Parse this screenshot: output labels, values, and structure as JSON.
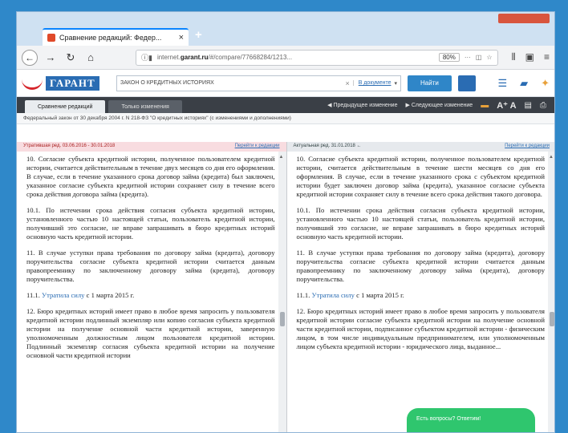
{
  "browser": {
    "tab_title": "Сравнение редакций: Федер...",
    "tab_close": "×",
    "new_tab": "+",
    "url_prefix": "internet.",
    "url_domain": "garant.ru",
    "url_rest": "/#/compare/77668284/1213...",
    "zoom": "80%",
    "nav_more": "···"
  },
  "garant": {
    "logo": "ГАРАНТ",
    "search_query": "ЗАКОН О КРЕДИТНЫХ ИСТОРИЯХ",
    "search_clear": "×",
    "search_scope": "В документе",
    "search_button": "Найти"
  },
  "doc_toolbar": {
    "tab_compare": "Сравнение редакций",
    "tab_changes": "Только изменения",
    "prev_change": "Предыдущее изменение",
    "next_change": "Следующее изменение",
    "font_size": "A⁺ A"
  },
  "doc_title": "Федеральный закон от 30 декабря 2004 г. N 218-ФЗ \"О кредитных историях\" (с изменениями и дополнениями)",
  "left_pane": {
    "header": "Утратившая ред. 03.06.2016 - 30.01.2018",
    "header_link": "Перейти к редакции",
    "p1": "10. Согласие субъекта кредитной истории, полученное пользователем кредитной истории, считается действительным в течение двух месяцев со дня его оформления. В случае, если в течение указанного срока договор займа (кредита) был заключен, указанное согласие субъекта кредитной истории сохраняет силу в течение всего срока действия договора займа (кредита).",
    "p2": "10.1. По истечении срока действия согласия субъекта кредитной истории, установленного частью 10 настоящей статьи, пользователь кредитной истории, получивший это согласие, не вправе запрашивать в бюро кредитных историй основную часть кредитной истории.",
    "p3": "11. В случае уступки права требования по договору займа (кредита), договору поручительства согласие субъекта кредитной истории считается данным правопреемнику по заключенному договору займа (кредита), договору поручительства.",
    "p4_link": "Утратила силу",
    "p4_rest": " с 1 марта 2015 г.",
    "p4_num": "11.1. ",
    "p5": "12. Бюро кредитных историй имеет право в любое время запросить у пользователя кредитной истории подлинный экземпляр или копию согласия субъекта кредитной истории на получение основной части кредитной истории, заверенную уполномоченным должностным лицом пользователя кредитной истории. Подлинный экземпляр согласия субъекта кредитной истории на получение основной части кредитной истории"
  },
  "right_pane": {
    "header": "Актуальная ред. 31.01.2018 ←",
    "header_link": "Перейти к редакции",
    "p1": "10. Согласие субъекта кредитной истории, полученное пользователем кредитной истории, считается действительным в течение шести месяцев со дня его оформления. В случае, если в течение указанного срока с субъектом кредитной истории будет заключен договор займа (кредита), указанное согласие субъекта кредитной истории сохраняет силу в течение всего срока действия такого договора.",
    "p2": "10.1. По истечении срока действия согласия субъекта кредитной истории, установленного частью 10 настоящей статьи, пользователь кредитной истории, получивший это согласие, не вправе запрашивать в бюро кредитных историй основную часть кредитной истории.",
    "p3": "11. В случае уступки права требования по договору займа (кредита), договору поручительства согласие субъекта кредитной истории считается данным правопреемнику по заключенному договору займа (кредита), договору поручительства.",
    "p4_link": "Утратила силу",
    "p4_rest": " с 1 марта 2015 г.",
    "p4_num": "11.1. ",
    "p5": "12. Бюро кредитных историй имеет право в любое время запросить у пользователя кредитной истории согласие субъекта кредитной истории на получение основной части кредитной истории, подписанное субъектом кредитной истории - физическим лицом, в том числе индивидуальным предпринимателем, или уполномоченным лицом субъекта кредитной истории - юридического лица, выданное..."
  },
  "chat": {
    "label": "Есть вопросы? Ответим!"
  }
}
